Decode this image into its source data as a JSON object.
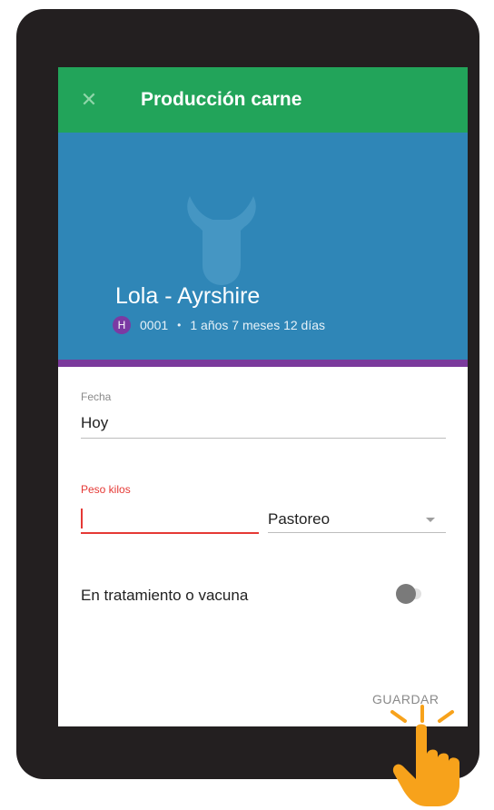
{
  "appbar": {
    "close_icon": "close-icon",
    "title": "Producción carne"
  },
  "animal": {
    "name": "Lola - Ayrshire",
    "sex_badge": "H",
    "id": "0001",
    "separator": "•",
    "age": "1 años 7 meses 12 días"
  },
  "form": {
    "date_label": "Fecha",
    "date_value": "Hoy",
    "weight_label": "Peso kilos",
    "weight_value": "",
    "feeding_selected": "Pastoreo",
    "treatment_label": "En tratamiento o vacuna",
    "treatment_enabled": false,
    "save_label": "GUARDAR"
  },
  "colors": {
    "appbar": "#22a45a",
    "hero": "#2f86b7",
    "accent": "#7b3a9c",
    "error": "#e53935",
    "hand": "#f7a21b"
  }
}
